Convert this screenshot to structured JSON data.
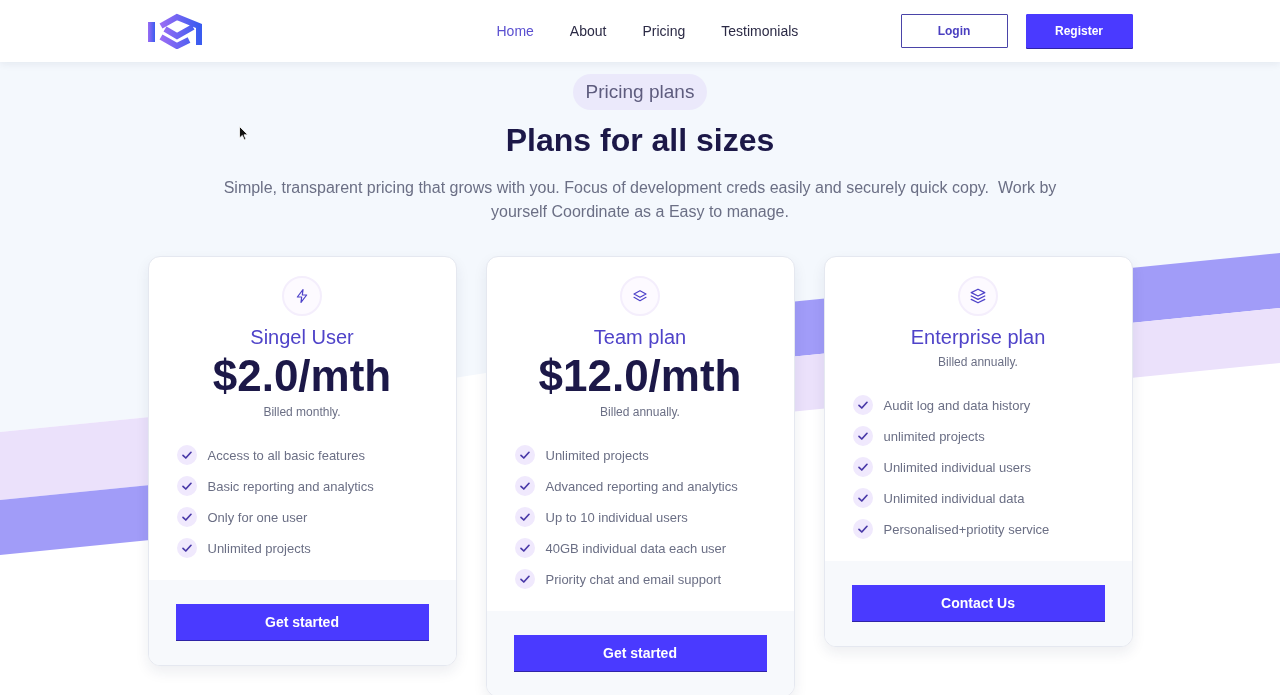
{
  "header": {
    "nav": [
      {
        "label": "Home",
        "selected": true
      },
      {
        "label": "About",
        "selected": false
      },
      {
        "label": "Pricing",
        "selected": false
      },
      {
        "label": "Testimonials",
        "selected": false
      }
    ],
    "buttons": [
      {
        "label": "Login",
        "kind": "outline"
      },
      {
        "label": "Register",
        "kind": "primary"
      }
    ]
  },
  "hero": {
    "badge": "Pricing plans",
    "title": "Plans for all sizes",
    "subtitle": "Simple, transparent pricing that grows with you. Focus of development creds easily and securely quick copy.  Work by yourself Coordinate as a Easy to manage."
  },
  "plans": [
    {
      "name": "Singel User",
      "price": "$2.0/mth",
      "billing": "Billed monthly.",
      "features": [
        "Access to all basic features",
        "Basic reporting and analytics",
        "Only for one user",
        "Unlimited projects"
      ],
      "button": "Get started"
    },
    {
      "name": "Team plan",
      "price": "$12.0/mth",
      "billing": "Billed annually.",
      "features": [
        "Unlimited projects",
        "Advanced reporting and analytics",
        "Up to 10 individual users",
        "40GB individual data each user",
        "Priority chat and email support"
      ],
      "button": "Get started"
    },
    {
      "name": "Enterprise plan",
      "billing": "Billed annually.",
      "features": [
        "Audit log and data history",
        "unlimited projects",
        "Unlimited individual users",
        "Unlimited individual data",
        "Personalised+priotity service"
      ],
      "button": "Contact Us"
    }
  ]
}
